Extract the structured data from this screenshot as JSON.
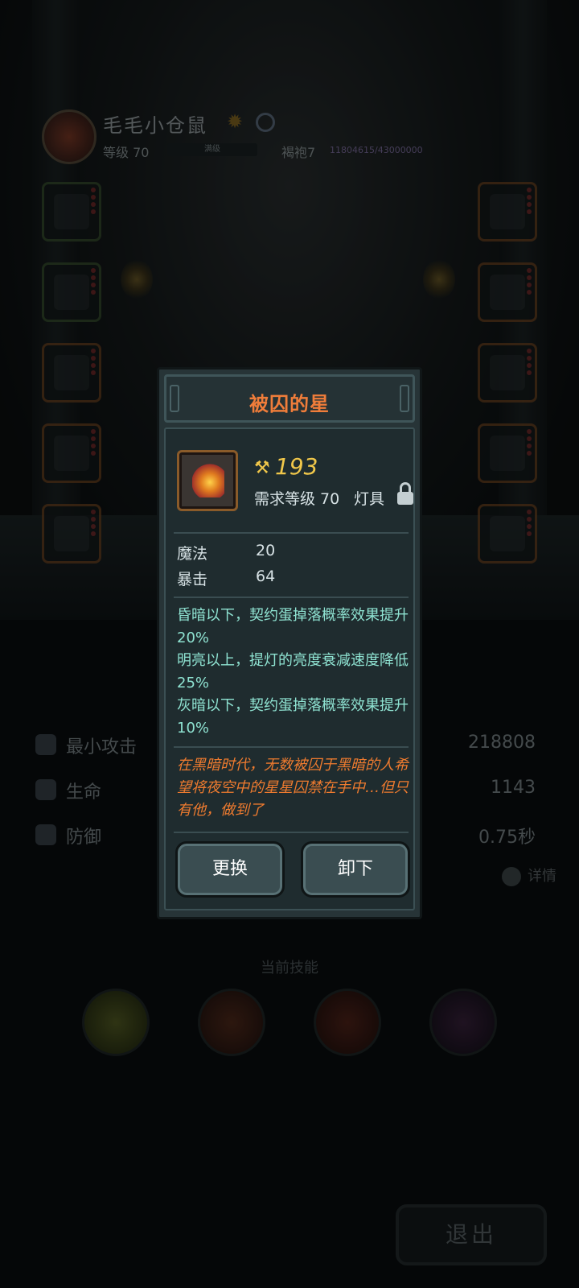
{
  "player": {
    "name": "毛毛小仓鼠",
    "level_label": "等级 70",
    "level_bar_text": "满级",
    "rank_label": "褐袍7",
    "rank_progress": "11804615/43000000"
  },
  "stats": [
    {
      "label": "最小攻击",
      "value": "218808"
    },
    {
      "label": "生命",
      "value": "1143"
    },
    {
      "label": "防御",
      "value": "0.75秒"
    }
  ],
  "details_label": "详情",
  "skills_title": "当前技能",
  "exit_label": "退出",
  "modal": {
    "title": "被囚的星",
    "power": "193",
    "required_level": "需求等级 70",
    "item_type": "灯具",
    "attributes": [
      {
        "name": "魔法",
        "value": "20"
      },
      {
        "name": "暴击",
        "value": "64"
      }
    ],
    "effects": [
      "昏暗以下，契约蛋掉落概率效果提升20%",
      "明亮以上，提灯的亮度衰减速度降低25%",
      "灰暗以下，契约蛋掉落概率效果提升10%"
    ],
    "flavor": "在黑暗时代，无数被囚于黑暗的人希望将夜空中的星星囚禁在手中…但只有他，做到了",
    "buttons": {
      "equip": "更换",
      "unequip": "卸下"
    }
  },
  "colors": {
    "title_orange": "#f07d3a",
    "power_gold": "#f0c74a",
    "effect_teal": "#8fe3d2",
    "flavor_orange": "#ef7b2f",
    "panel_bg": "#273437"
  }
}
